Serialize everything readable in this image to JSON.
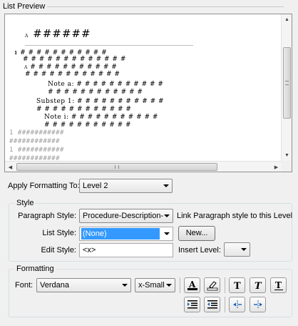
{
  "preview_group": {
    "title": "List Preview",
    "lines": [
      {
        "prefix": "A",
        "text": "######"
      },
      {
        "prefix": "1",
        "text": "# # # # # # # # # # #"
      },
      {
        "text": "# # # # # # # # # # # # #"
      },
      {
        "prefix": "A",
        "text": "# # # # # # # # # # #"
      },
      {
        "text": "# # # # # # # # # # # #"
      },
      {
        "text": "Note a: # # # # # # # # # # #"
      },
      {
        "text": "# # # # # # # # # # # #"
      },
      {
        "text": "Substep 1: # # # # # # # # # # #"
      },
      {
        "text": "# # # # # # # # # # # #"
      },
      {
        "text": "Note i: # # # # # # # # # # #"
      },
      {
        "text": "# # # # # # # # # # #"
      },
      {
        "text": "1 ###########"
      },
      {
        "text": "############"
      },
      {
        "text": "1 ###########"
      },
      {
        "text": "############"
      }
    ],
    "scroll_grip": "III"
  },
  "apply": {
    "label": "Apply Formatting To:",
    "value": "Level 2"
  },
  "style_group": {
    "title": "Style",
    "paragraph_style_label": "Paragraph Style:",
    "paragraph_style_value": "Procedure-Description-",
    "link_label": "Link Paragraph style to this Level",
    "list_style_label": "List Style:",
    "list_style_value": "(None)",
    "new_button": "New...",
    "edit_style_label": "Edit Style:",
    "edit_style_value": "<x>",
    "insert_level_label": "Insert Level:",
    "insert_level_value": ""
  },
  "formatting_group": {
    "title": "Formatting",
    "font_label": "Font:",
    "font_value": "Verdana",
    "size_value": "x-Small",
    "icons": [
      "text-color-icon",
      "highlight-icon",
      "bold-icon",
      "italic-icon",
      "underline-icon",
      "align-indent-icon",
      "align-outdent-icon",
      "decrease-indent-icon",
      "increase-indent-icon"
    ]
  },
  "colors": {
    "selection": "#3399ff",
    "text_color_bar": "#000000",
    "highlight_bar": "#ffffff"
  }
}
